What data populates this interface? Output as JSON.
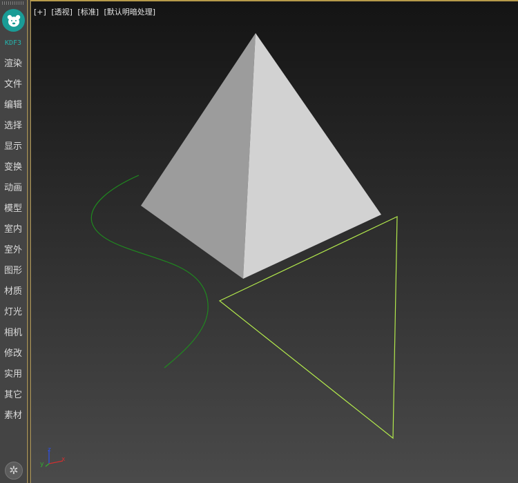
{
  "sidebar": {
    "brand": "KDF3",
    "logo_icon": "bear-face-icon",
    "items": [
      {
        "label": "渲染"
      },
      {
        "label": "文件"
      },
      {
        "label": "编辑"
      },
      {
        "label": "选择"
      },
      {
        "label": "显示"
      },
      {
        "label": "变换"
      },
      {
        "label": "动画"
      },
      {
        "label": "模型"
      },
      {
        "label": "室内"
      },
      {
        "label": "室外"
      },
      {
        "label": "图形"
      },
      {
        "label": "材质"
      },
      {
        "label": "灯光"
      },
      {
        "label": "相机"
      },
      {
        "label": "修改"
      },
      {
        "label": "实用"
      },
      {
        "label": "其它"
      },
      {
        "label": "素材"
      }
    ],
    "settings_icon": "gear-icon"
  },
  "viewport": {
    "labels": [
      "[+]",
      "[透视]",
      "[标准]",
      "[默认明暗处理]"
    ],
    "objects": [
      "pyramid",
      "green-spline",
      "yellow-triangle-spline"
    ],
    "colors": {
      "pyramid_left_face": "#9c9c9c",
      "pyramid_right_face": "#d2d2d2",
      "spline_green": "#1f8a1f",
      "selected_spline": "#b3ea4c",
      "axis_x": "#d03030",
      "axis_y": "#30b030",
      "axis_z": "#3050e0"
    },
    "axis_labels": {
      "x": "x",
      "y": "y",
      "z": "z"
    }
  }
}
